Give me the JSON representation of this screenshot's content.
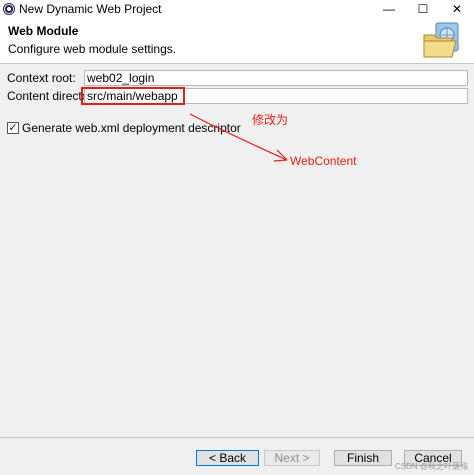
{
  "window": {
    "title": "New Dynamic Web Project",
    "minimize_glyph": "—",
    "maximize_glyph": "☐",
    "close_glyph": "✕"
  },
  "header": {
    "title": "Web Module",
    "description": "Configure web module settings."
  },
  "form": {
    "context_root_label": "Context root:",
    "context_root_value": "web02_login",
    "content_directory_label": "Content directory:",
    "content_directory_value": "src/main/webapp",
    "generate_web_xml_label": "Generate web.xml deployment descriptor",
    "generate_web_xml_checked": true
  },
  "annotation": {
    "note": "修改为",
    "target": "WebContent",
    "color": "#e81c1c"
  },
  "buttons": {
    "back": "< Back",
    "next": "Next >",
    "finish": "Finish",
    "cancel": "Cancel"
  },
  "watermark": "CSDN @秋之叶落殇"
}
